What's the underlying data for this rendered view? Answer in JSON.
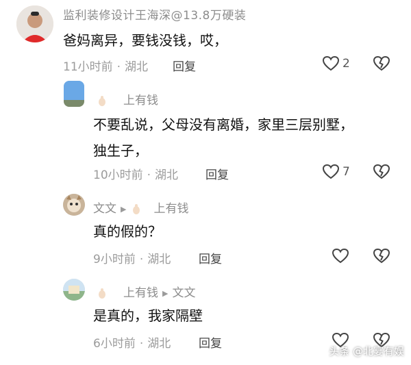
{
  "comments": [
    {
      "author": "监利装修设计王海深@13.8万硬装",
      "text": "爸妈离异，要钱没钱，哎，",
      "time": "11小时前",
      "location": "湖北",
      "reply_label": "回复",
      "likes": "2"
    },
    {
      "author": "上有钱",
      "text_line1": "不要乱说，父母没有离婚，家里三层别墅，",
      "text_line2": "独生子，",
      "time": "10小时前",
      "location": "湖北",
      "reply_label": "回复",
      "likes": "7"
    },
    {
      "author": "文文",
      "reply_to": "上有钱",
      "text": "真的假的？",
      "time": "9小时前",
      "location": "湖北",
      "reply_label": "回复"
    },
    {
      "author": "上有钱",
      "reply_to": "文文",
      "text": "是真的，我家隔壁",
      "time": "6小时前",
      "location": "湖北",
      "reply_label": "回复"
    }
  ],
  "separator": "·",
  "watermark": "头条 @北宴有娱",
  "colors": {
    "meta": "#9b9b9b",
    "text": "#111111",
    "background": "#ffffff"
  }
}
